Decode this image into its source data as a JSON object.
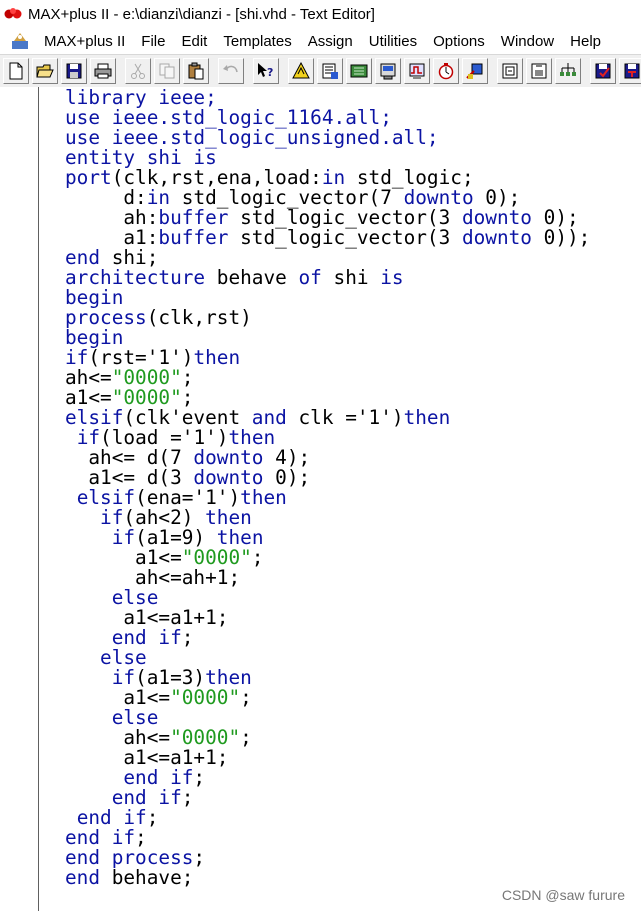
{
  "window": {
    "title": "MAX+plus II - e:\\dianzi\\dianzi - [shi.vhd - Text Editor]"
  },
  "menu": {
    "items": [
      "MAX+plus II",
      "File",
      "Edit",
      "Templates",
      "Assign",
      "Utilities",
      "Options",
      "Window",
      "Help"
    ]
  },
  "toolbar": {
    "buttons": [
      {
        "icon": "new-file-icon"
      },
      {
        "icon": "open-folder-icon"
      },
      {
        "icon": "save-icon"
      },
      {
        "icon": "print-icon"
      },
      {
        "icon": "cut-icon"
      },
      {
        "icon": "copy-icon"
      },
      {
        "icon": "paste-icon"
      },
      {
        "icon": "undo-icon"
      },
      {
        "icon": "context-help-icon"
      },
      {
        "icon": "hierarchy-up-icon"
      },
      {
        "icon": "hierarchy-display-icon"
      },
      {
        "icon": "floorplan-editor-icon"
      },
      {
        "icon": "compiler-icon"
      },
      {
        "icon": "simulator-icon"
      },
      {
        "icon": "timing-analyzer-icon"
      },
      {
        "icon": "programmer-icon"
      },
      {
        "icon": "project-set-icon"
      },
      {
        "icon": "project-save-check-icon"
      },
      {
        "icon": "project-save-compile-icon"
      },
      {
        "icon": "project-save-simulate-icon"
      },
      {
        "icon": "window-tile-icon"
      }
    ]
  },
  "editor": {
    "lines": [
      [
        {
          "t": "library ieee;",
          "c": "kw"
        }
      ],
      [
        {
          "t": "use ieee.std_logic_1164.",
          "c": "kw"
        },
        {
          "t": "all",
          "c": "kw"
        },
        {
          "t": ";",
          "c": "kw"
        }
      ],
      [
        {
          "t": "use ieee.std_logic_unsigned.all;",
          "c": "kw"
        }
      ],
      [
        {
          "t": "entity shi is",
          "c": "kw"
        }
      ],
      [
        {
          "t": "port",
          "c": "kw"
        },
        {
          "t": "(clk,rst,ena,load:",
          "c": ""
        },
        {
          "t": "in",
          "c": "kw"
        },
        {
          "t": " std_logic;",
          "c": ""
        }
      ],
      [
        {
          "t": "     d:",
          "c": ""
        },
        {
          "t": "in",
          "c": "kw"
        },
        {
          "t": " std_logic_vector(7 ",
          "c": ""
        },
        {
          "t": "downto",
          "c": "kw"
        },
        {
          "t": " 0);",
          "c": ""
        }
      ],
      [
        {
          "t": "     ah:",
          "c": ""
        },
        {
          "t": "buffer",
          "c": "kw"
        },
        {
          "t": " std_logic_vector(3 ",
          "c": ""
        },
        {
          "t": "downto",
          "c": "kw"
        },
        {
          "t": " 0);",
          "c": ""
        }
      ],
      [
        {
          "t": "     a1:",
          "c": ""
        },
        {
          "t": "buffer",
          "c": "kw"
        },
        {
          "t": " std_logic_vector(3 ",
          "c": ""
        },
        {
          "t": "downto",
          "c": "kw"
        },
        {
          "t": " 0));",
          "c": ""
        }
      ],
      [
        {
          "t": "end",
          "c": "kw"
        },
        {
          "t": " shi;",
          "c": ""
        }
      ],
      [
        {
          "t": "architecture",
          "c": "kw"
        },
        {
          "t": " behave ",
          "c": ""
        },
        {
          "t": "of",
          "c": "kw"
        },
        {
          "t": " shi ",
          "c": ""
        },
        {
          "t": "is",
          "c": "kw"
        }
      ],
      [
        {
          "t": "begin",
          "c": "kw"
        }
      ],
      [
        {
          "t": "process",
          "c": "kw"
        },
        {
          "t": "(clk,rst)",
          "c": ""
        }
      ],
      [
        {
          "t": "begin",
          "c": "kw"
        }
      ],
      [
        {
          "t": "if",
          "c": "kw"
        },
        {
          "t": "(rst='1')",
          "c": ""
        },
        {
          "t": "then",
          "c": "kw"
        }
      ],
      [
        {
          "t": "ah<=",
          "c": ""
        },
        {
          "t": "\"0000\"",
          "c": "str"
        },
        {
          "t": ";",
          "c": ""
        }
      ],
      [
        {
          "t": "a1<=",
          "c": ""
        },
        {
          "t": "\"0000\"",
          "c": "str"
        },
        {
          "t": ";",
          "c": ""
        }
      ],
      [
        {
          "t": "elsif",
          "c": "kw"
        },
        {
          "t": "(clk'event ",
          "c": ""
        },
        {
          "t": "and",
          "c": "kw"
        },
        {
          "t": " clk ='1')",
          "c": ""
        },
        {
          "t": "then",
          "c": "kw"
        }
      ],
      [
        {
          "t": " ",
          "c": ""
        },
        {
          "t": "if",
          "c": "kw"
        },
        {
          "t": "(load ='1')",
          "c": ""
        },
        {
          "t": "then",
          "c": "kw"
        }
      ],
      [
        {
          "t": "  ah<= d(7 ",
          "c": ""
        },
        {
          "t": "downto",
          "c": "kw"
        },
        {
          "t": " 4);",
          "c": ""
        }
      ],
      [
        {
          "t": "  a1<= d(3 ",
          "c": ""
        },
        {
          "t": "downto",
          "c": "kw"
        },
        {
          "t": " 0);",
          "c": ""
        }
      ],
      [
        {
          "t": " ",
          "c": ""
        },
        {
          "t": "elsif",
          "c": "kw"
        },
        {
          "t": "(ena='1')",
          "c": ""
        },
        {
          "t": "then",
          "c": "kw"
        }
      ],
      [
        {
          "t": "   ",
          "c": ""
        },
        {
          "t": "if",
          "c": "kw"
        },
        {
          "t": "(ah<2) ",
          "c": ""
        },
        {
          "t": "then",
          "c": "kw"
        }
      ],
      [
        {
          "t": "    ",
          "c": ""
        },
        {
          "t": "if",
          "c": "kw"
        },
        {
          "t": "(a1=9) ",
          "c": ""
        },
        {
          "t": "then",
          "c": "kw"
        }
      ],
      [
        {
          "t": "      a1<=",
          "c": ""
        },
        {
          "t": "\"0000\"",
          "c": "str"
        },
        {
          "t": ";",
          "c": ""
        }
      ],
      [
        {
          "t": "      ah<=ah+1;",
          "c": ""
        }
      ],
      [
        {
          "t": "    ",
          "c": ""
        },
        {
          "t": "else",
          "c": "kw"
        }
      ],
      [
        {
          "t": "     a1<=a1+1;",
          "c": ""
        }
      ],
      [
        {
          "t": "    ",
          "c": ""
        },
        {
          "t": "end if",
          "c": "kw"
        },
        {
          "t": ";",
          "c": ""
        }
      ],
      [
        {
          "t": "   ",
          "c": ""
        },
        {
          "t": "else",
          "c": "kw"
        }
      ],
      [
        {
          "t": "    ",
          "c": ""
        },
        {
          "t": "if",
          "c": "kw"
        },
        {
          "t": "(a1=3)",
          "c": ""
        },
        {
          "t": "then",
          "c": "kw"
        }
      ],
      [
        {
          "t": "     a1<=",
          "c": ""
        },
        {
          "t": "\"0000\"",
          "c": "str"
        },
        {
          "t": ";",
          "c": ""
        }
      ],
      [
        {
          "t": "    ",
          "c": ""
        },
        {
          "t": "else",
          "c": "kw"
        }
      ],
      [
        {
          "t": "     ah<=",
          "c": ""
        },
        {
          "t": "\"0000\"",
          "c": "str"
        },
        {
          "t": ";",
          "c": ""
        }
      ],
      [
        {
          "t": "     a1<=a1+1;",
          "c": ""
        }
      ],
      [
        {
          "t": "     ",
          "c": ""
        },
        {
          "t": "end if",
          "c": "kw"
        },
        {
          "t": ";",
          "c": ""
        }
      ],
      [
        {
          "t": "    ",
          "c": ""
        },
        {
          "t": "end if",
          "c": "kw"
        },
        {
          "t": ";",
          "c": ""
        }
      ],
      [
        {
          "t": " ",
          "c": ""
        },
        {
          "t": "end if",
          "c": "kw"
        },
        {
          "t": ";",
          "c": ""
        }
      ],
      [
        {
          "t": "end if",
          "c": "kw"
        },
        {
          "t": ";",
          "c": ""
        }
      ],
      [
        {
          "t": "end process",
          "c": "kw"
        },
        {
          "t": ";",
          "c": ""
        }
      ],
      [
        {
          "t": "end",
          "c": "kw"
        },
        {
          "t": " behave;",
          "c": ""
        }
      ]
    ]
  },
  "watermark": "CSDN @saw furure",
  "colors": {
    "keyword": "#0b13a3",
    "string": "#1f9a1f",
    "text": "#000000"
  }
}
